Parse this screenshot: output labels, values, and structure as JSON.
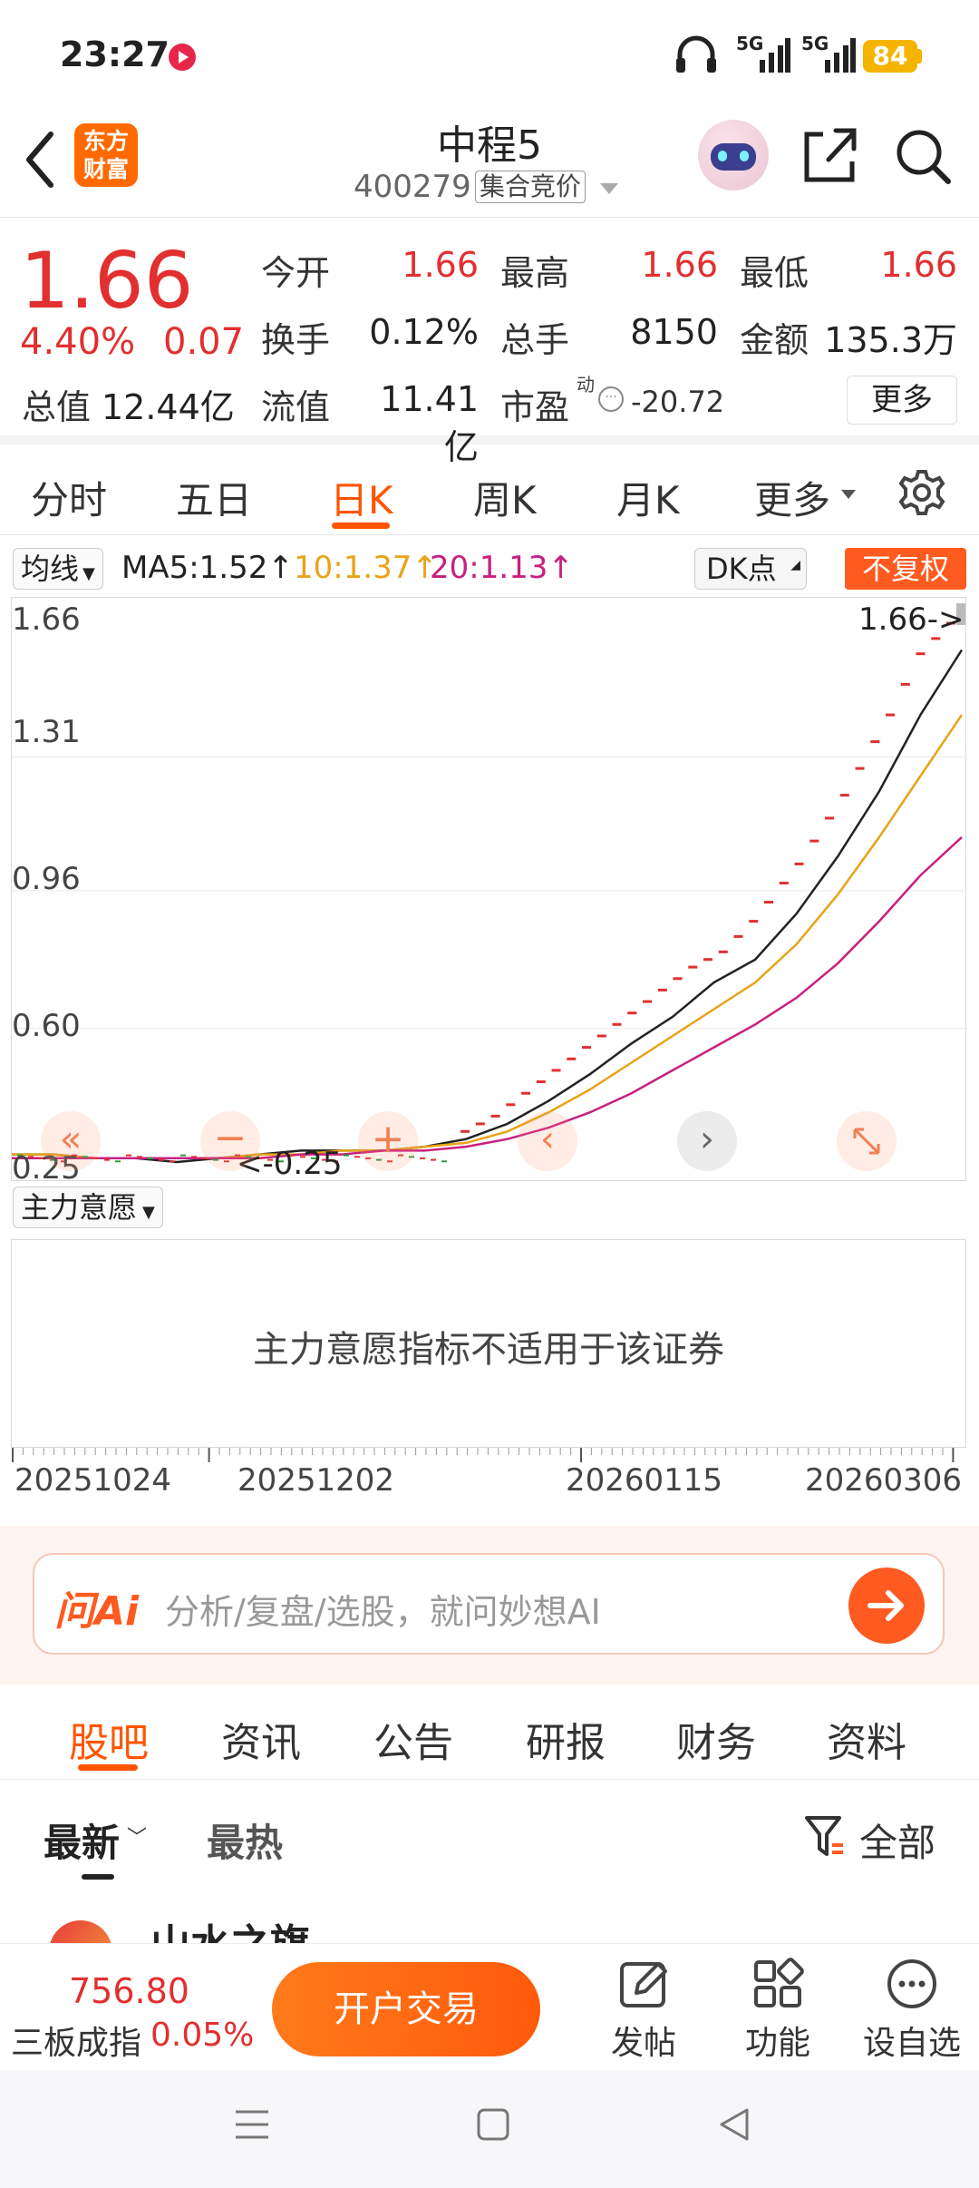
{
  "status_bar": {
    "time": "23:27",
    "net1": "5G",
    "net2": "5G",
    "battery": "84"
  },
  "header": {
    "logo_line1": "东方",
    "logo_line2": "财富",
    "stock_name": "中程5",
    "stock_code": "400279",
    "auction_tag": "集合竞价"
  },
  "quote": {
    "price": "1.66",
    "change_pct": "4.40%",
    "change_amt": "0.07",
    "open_label": "今开",
    "open": "1.66",
    "high_label": "最高",
    "high": "1.66",
    "low_label": "最低",
    "low": "1.66",
    "turnover_label": "换手",
    "turnover": "0.12%",
    "volume_label": "总手",
    "volume": "8150",
    "amount_label": "金额",
    "amount": "135.3万",
    "total_cap_label": "总值",
    "total_cap": "12.44亿",
    "float_cap_label": "流值",
    "float_cap": "11.41亿",
    "pe_label": "市盈",
    "pe_sup": "动",
    "pe": "-20.72",
    "more_button": "更多"
  },
  "kline_tabs": [
    "分时",
    "五日",
    "日K",
    "周K",
    "月K",
    "更多"
  ],
  "ma": {
    "selector": "均线",
    "ma5": "MA5:1.52↑",
    "ma10": "10:1.37↑",
    "ma20": "20:1.13↑",
    "dk": "DK点",
    "adjust": "不复权",
    "ma5_color": "#222222",
    "ma10_color": "#e8a317",
    "ma20_color": "#c8207f"
  },
  "chart_data": {
    "type": "line",
    "y_ticks": [
      "1.66",
      "1.31",
      "0.96",
      "0.60",
      "0.25"
    ],
    "ylim": [
      0.25,
      1.66
    ],
    "x_ticks": [
      "20251024",
      "20251202",
      "20260115",
      "20260306"
    ],
    "max_label": "1.66->",
    "min_label": "<-0.25",
    "series": [
      {
        "values": [
          0.27,
          0.27,
          0.26,
          0.26,
          0.25,
          0.26,
          0.27,
          0.28,
          0.28,
          0.28,
          0.29,
          0.31,
          0.35,
          0.41,
          0.48,
          0.56,
          0.63,
          0.72,
          0.78,
          0.9,
          1.05,
          1.22,
          1.42,
          1.59
        ]
      },
      {
        "values": [
          0.27,
          0.27,
          0.26,
          0.26,
          0.26,
          0.26,
          0.27,
          0.27,
          0.28,
          0.28,
          0.29,
          0.3,
          0.33,
          0.38,
          0.44,
          0.51,
          0.58,
          0.65,
          0.72,
          0.82,
          0.95,
          1.1,
          1.26,
          1.42
        ]
      },
      {
        "values": [
          0.26,
          0.26,
          0.26,
          0.26,
          0.26,
          0.26,
          0.26,
          0.27,
          0.27,
          0.28,
          0.28,
          0.29,
          0.31,
          0.34,
          0.38,
          0.43,
          0.49,
          0.55,
          0.61,
          0.68,
          0.77,
          0.88,
          1.0,
          1.1
        ]
      }
    ],
    "candles_close": [
      0.33,
      0.35,
      0.37,
      0.4,
      0.43,
      0.46,
      0.49,
      0.52,
      0.55,
      0.58,
      0.61,
      0.64,
      0.67,
      0.7,
      0.73,
      0.76,
      0.78,
      0.8,
      0.84,
      0.88,
      0.93,
      0.98,
      1.03,
      1.09,
      1.15,
      1.21,
      1.28,
      1.35,
      1.42,
      1.5,
      1.58,
      1.62,
      1.66
    ]
  },
  "indicator": {
    "selector": "主力意愿",
    "message": "主力意愿指标不适用于该证券"
  },
  "ai_bar": {
    "brand": "问Ai",
    "placeholder": "分析/复盘/选股，就问妙想AI"
  },
  "content_tabs": [
    "股吧",
    "资讯",
    "公告",
    "研报",
    "财务",
    "资料"
  ],
  "sort": {
    "latest": "最新",
    "hot": "最热",
    "filter": "全部"
  },
  "post_preview": "山水之旗",
  "bottom_bar": {
    "index_value": "756.80",
    "index_name": "三板成指",
    "index_change": "0.05%",
    "trade_button": "开户交易",
    "post": "发帖",
    "function": "功能",
    "watchlist": "设自选"
  }
}
